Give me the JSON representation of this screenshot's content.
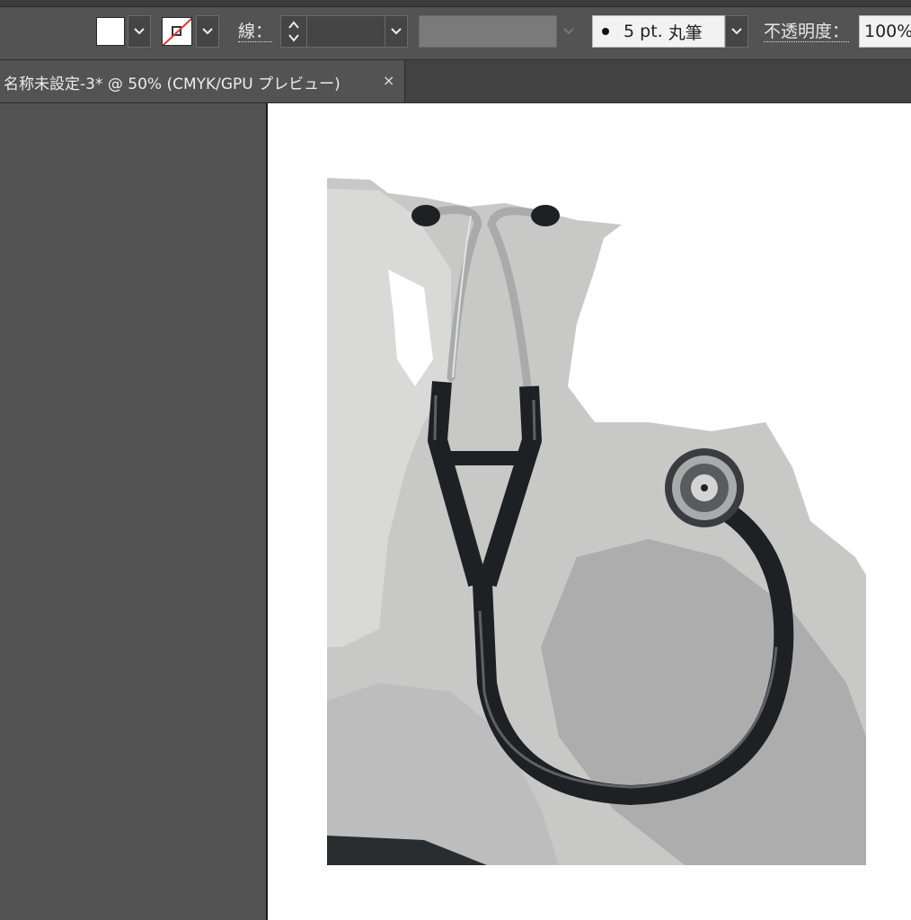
{
  "control_bar": {
    "stroke_label": "線：",
    "stroke_weight": "",
    "brush_size": "5 pt.",
    "brush_name": "丸筆",
    "opacity_label": "不透明度：",
    "opacity_value": "100%"
  },
  "document_tab": {
    "title": "名称未設定-3* @ 50% (CMYK/GPU プレビュー)",
    "close_glyph": "×"
  },
  "artwork": {
    "subject": "stethoscope-photo-trace",
    "colors": {
      "tube": "#1e2124",
      "tube_highlight": "#5d6166",
      "metal": "#a9abab",
      "background_light": "#d9d9d7",
      "background_mid": "#bebebe",
      "background_dark": "#adadad"
    }
  },
  "icons": {
    "chevron": "chevron-down-icon",
    "spinner": "up-down-spinner-icon",
    "close": "close-icon"
  }
}
